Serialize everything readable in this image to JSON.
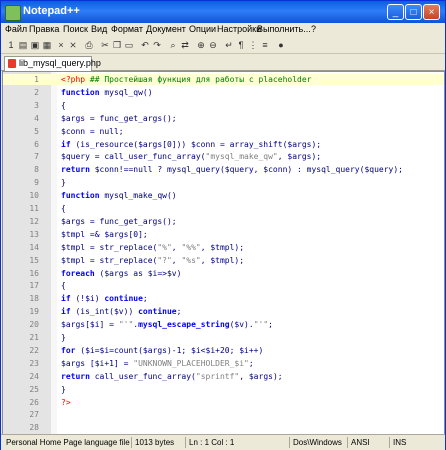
{
  "window": {
    "title": "Notepad++",
    "minimize_glyph": "_",
    "maximize_glyph": "□",
    "close_glyph": "×"
  },
  "menu": [
    "Файл",
    "Правка",
    "Поиск",
    "Вид",
    "Формат",
    "Документ",
    "Опции",
    "Настройки",
    "Выполнить...",
    "?"
  ],
  "toolbar_icons": [
    "new-file-icon",
    "open-file-icon",
    "save-icon",
    "save-all-icon",
    "close-icon",
    "close-all-icon",
    "print-icon",
    "cut-icon",
    "copy-icon",
    "paste-icon",
    "undo-icon",
    "redo-icon",
    "find-icon",
    "replace-icon",
    "zoom-in-icon",
    "zoom-out-icon",
    "word-wrap-icon",
    "show-all-chars-icon",
    "indent-guide-icon",
    "user-lang-icon",
    "macro-record-icon"
  ],
  "tab": {
    "label": "lib_mysql_query.php"
  },
  "editor": {
    "current_line": 1,
    "lines": [
      {
        "n": "1",
        "parts": [
          [
            "tag",
            "<?php"
          ],
          [
            "comment",
            " ## Простейшая функция для работы с placeholder"
          ]
        ]
      },
      {
        "n": "2",
        "parts": [
          [
            "keyword",
            "function"
          ],
          [
            "default",
            " mysql_qw()"
          ]
        ]
      },
      {
        "n": "3",
        "parts": [
          [
            "default",
            "{"
          ]
        ]
      },
      {
        "n": "4",
        "parts": [
          [
            "var",
            "$args"
          ],
          [
            "default",
            " = func_get_args();"
          ]
        ]
      },
      {
        "n": "5",
        "parts": [
          [
            "var",
            "$conn"
          ],
          [
            "default",
            " = null;"
          ]
        ]
      },
      {
        "n": "6",
        "parts": [
          [
            "keyword",
            "if"
          ],
          [
            "default",
            " (is_resource($args[0])) $conn = array_shift($args);"
          ]
        ]
      },
      {
        "n": "7",
        "parts": [
          [
            "var",
            "$query"
          ],
          [
            "default",
            " = call_user_func_array("
          ],
          [
            "string",
            "\"mysql_make_qw\""
          ],
          [
            "default",
            ", $args);"
          ]
        ]
      },
      {
        "n": "8",
        "parts": [
          [
            "keyword",
            "return"
          ],
          [
            "default",
            " $conn!==null ? mysql_query($query, $conn) : mysql_query($query);"
          ]
        ]
      },
      {
        "n": "9",
        "parts": [
          [
            "default",
            "}"
          ]
        ]
      },
      {
        "n": "10",
        "parts": [
          [
            "keyword",
            "function"
          ],
          [
            "default",
            " mysql_make_qw()"
          ]
        ]
      },
      {
        "n": "11",
        "parts": [
          [
            "default",
            "{"
          ]
        ]
      },
      {
        "n": "12",
        "parts": [
          [
            "var",
            "$args"
          ],
          [
            "default",
            " = func_get_args();"
          ]
        ]
      },
      {
        "n": "13",
        "parts": [
          [
            "var",
            "$tmpl"
          ],
          [
            "default",
            " =& $args[0];"
          ]
        ]
      },
      {
        "n": "14",
        "parts": [
          [
            "var",
            "$tmpl"
          ],
          [
            "default",
            " = str_replace("
          ],
          [
            "string",
            "\"%\""
          ],
          [
            "default",
            ", "
          ],
          [
            "string",
            "\"%%\""
          ],
          [
            "default",
            ", $tmpl);"
          ]
        ]
      },
      {
        "n": "15",
        "parts": [
          [
            "var",
            "$tmpl"
          ],
          [
            "default",
            " = str_replace("
          ],
          [
            "string",
            "\"?\""
          ],
          [
            "default",
            ", "
          ],
          [
            "string",
            "\"%s\""
          ],
          [
            "default",
            ", $tmpl);"
          ]
        ]
      },
      {
        "n": "16",
        "parts": [
          [
            "keyword",
            "foreach"
          ],
          [
            "default",
            " ($args as $i=>$v)"
          ]
        ]
      },
      {
        "n": "17",
        "parts": [
          [
            "default",
            "{"
          ]
        ]
      },
      {
        "n": "18",
        "parts": [
          [
            "keyword",
            "if"
          ],
          [
            "default",
            " (!$i) "
          ],
          [
            "keyword",
            "continue"
          ],
          [
            "default",
            ";"
          ]
        ]
      },
      {
        "n": "19",
        "parts": [
          [
            "keyword",
            "if"
          ],
          [
            "default",
            " (is_int($v)) "
          ],
          [
            "keyword",
            "continue"
          ],
          [
            "default",
            ";"
          ]
        ]
      },
      {
        "n": "20",
        "parts": [
          [
            "var",
            "$args[$i]"
          ],
          [
            "default",
            " = "
          ],
          [
            "string",
            "\"'\""
          ],
          [
            "default",
            "."
          ],
          [
            "keyword",
            "mysql_escape_string"
          ],
          [
            "default",
            "($v)."
          ],
          [
            "string",
            "\"'\""
          ],
          [
            "default",
            ";"
          ]
        ]
      },
      {
        "n": "21",
        "parts": [
          [
            "default",
            "}"
          ]
        ]
      },
      {
        "n": "22",
        "parts": [
          [
            "keyword",
            "for"
          ],
          [
            "default",
            " ($i=$i=count($args)-1; $i<$i+20; $i++)"
          ]
        ]
      },
      {
        "n": "23",
        "parts": [
          [
            "var",
            "$args"
          ],
          [
            "default",
            " [$i+1] = "
          ],
          [
            "string",
            "\"UNKNOWN_PLACEHOLDER_$i\""
          ],
          [
            "default",
            ";"
          ]
        ]
      },
      {
        "n": "24",
        "parts": [
          [
            "keyword",
            "return"
          ],
          [
            "default",
            " call_user_func_array("
          ],
          [
            "string",
            "\"sprintf\""
          ],
          [
            "default",
            ", $args);"
          ]
        ]
      },
      {
        "n": "25",
        "parts": [
          [
            "default",
            "}"
          ]
        ]
      },
      {
        "n": "26",
        "parts": [
          [
            "tag",
            "?>"
          ]
        ]
      },
      {
        "n": "27",
        "parts": []
      },
      {
        "n": "28",
        "parts": []
      }
    ]
  },
  "status": {
    "filetype": "Personal Home Page language file",
    "size": "1013 bytes",
    "position": "Ln : 1   Col : 1",
    "eol": "Dos\\Windows",
    "encoding": "ANSI",
    "mode": "INS"
  }
}
